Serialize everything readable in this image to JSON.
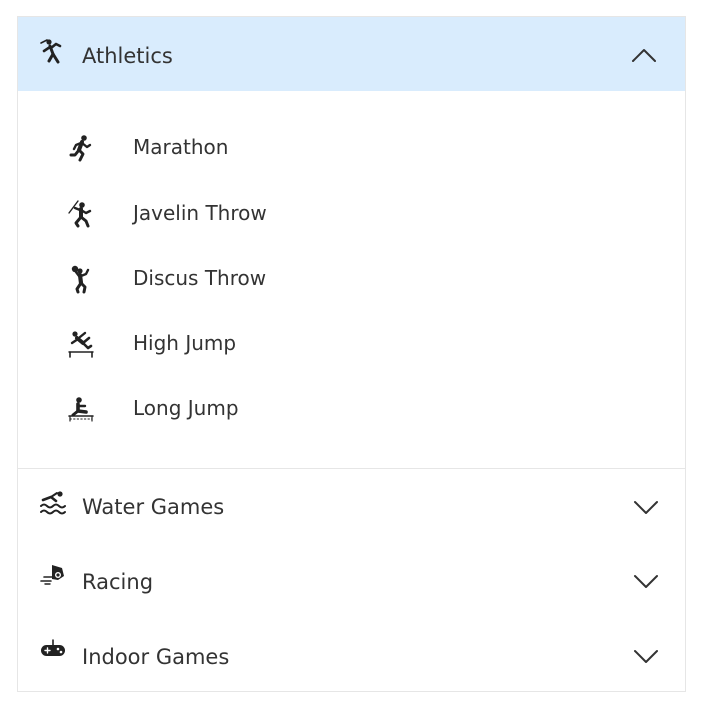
{
  "accordion": {
    "expanded": {
      "label": "Athletics",
      "icon": "athletics-icon",
      "chevron": "chevron-up-icon",
      "items": [
        {
          "label": "Marathon",
          "icon": "marathon-runner-icon"
        },
        {
          "label": "Javelin Throw",
          "icon": "javelin-throw-icon"
        },
        {
          "label": "Discus Throw",
          "icon": "discus-throw-icon"
        },
        {
          "label": "High Jump",
          "icon": "high-jump-icon"
        },
        {
          "label": "Long Jump",
          "icon": "long-jump-icon"
        }
      ]
    },
    "collapsed": [
      {
        "label": "Water Games",
        "icon": "swimming-icon",
        "chevron": "chevron-down-icon"
      },
      {
        "label": "Racing",
        "icon": "racing-icon",
        "chevron": "chevron-down-icon"
      },
      {
        "label": "Indoor Games",
        "icon": "gamepad-icon",
        "chevron": "chevron-down-icon"
      }
    ]
  },
  "colors": {
    "header_highlight": "#d9ecfd",
    "text": "#333333",
    "icon": "#222222",
    "border": "#e6e6e6"
  }
}
